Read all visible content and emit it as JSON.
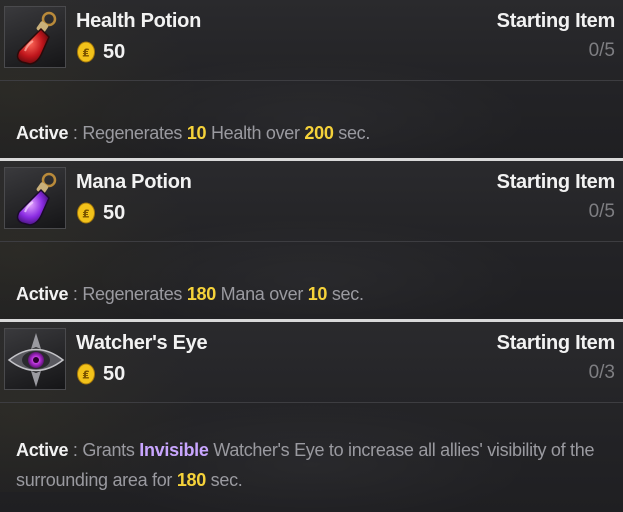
{
  "items": [
    {
      "name": "Health Potion",
      "icon": "health-potion-icon",
      "cost": "50",
      "category": "Starting Item",
      "stock": "0/5",
      "description": {
        "label": "Active",
        "sep": " : ",
        "segments": [
          {
            "text": "Regenerates ",
            "style": "text"
          },
          {
            "text": "10",
            "style": "num"
          },
          {
            "text": " Health over ",
            "style": "text"
          },
          {
            "text": "200",
            "style": "num"
          },
          {
            "text": " sec.",
            "style": "text"
          }
        ]
      }
    },
    {
      "name": "Mana Potion",
      "icon": "mana-potion-icon",
      "cost": "50",
      "category": "Starting Item",
      "stock": "0/5",
      "description": {
        "label": "Active",
        "sep": " : ",
        "segments": [
          {
            "text": "Regenerates ",
            "style": "text"
          },
          {
            "text": "180",
            "style": "num"
          },
          {
            "text": " Mana over ",
            "style": "text"
          },
          {
            "text": "10",
            "style": "num"
          },
          {
            "text": " sec.",
            "style": "text"
          }
        ]
      }
    },
    {
      "name": "Watcher's Eye",
      "icon": "watchers-eye-icon",
      "cost": "50",
      "category": "Starting Item",
      "stock": "0/3",
      "description": {
        "label": "Active",
        "sep": " : ",
        "segments": [
          {
            "text": "Grants ",
            "style": "text"
          },
          {
            "text": "Invisible",
            "style": "kw"
          },
          {
            "text": " Watcher's Eye to increase all allies' visibility of the surrounding area for ",
            "style": "text"
          },
          {
            "text": "180",
            "style": "num"
          },
          {
            "text": " sec.",
            "style": "text"
          }
        ]
      }
    }
  ],
  "colors": {
    "highlight_number": "#f5d23a",
    "highlight_keyword": "#c9a6ff",
    "coin": "#f2c21a",
    "health_potion": "#c0161c",
    "mana_potion": "#8a2be2",
    "watchers_eye": "#b02cd4"
  }
}
